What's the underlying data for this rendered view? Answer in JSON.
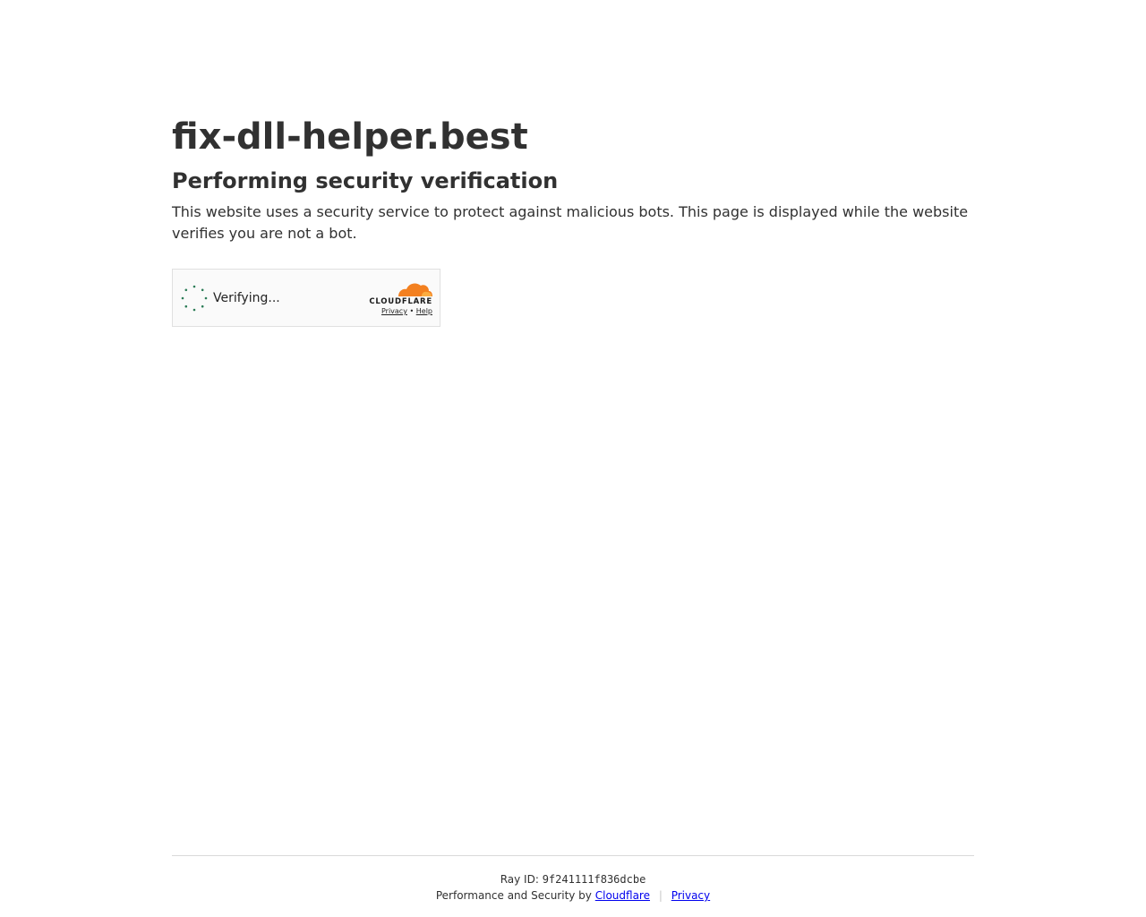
{
  "site": {
    "domain": "fix-dll-helper.best"
  },
  "content": {
    "heading": "Performing security verification",
    "description": "This website uses a security service to protect against malicious bots. This page is displayed while the website verifies you are not a bot."
  },
  "widget": {
    "status": "Verifying...",
    "brand": "CLOUDFLARE",
    "privacy_label": "Privacy",
    "bullet": "•",
    "help_label": "Help",
    "spinner_color": "#2c7c57",
    "cloud_color": "#f38020",
    "cloud_light_color": "#fbad41"
  },
  "footer": {
    "ray_label": "Ray ID:",
    "ray_id": "9f241111f836dcbe",
    "perf_prefix": "Performance and Security by",
    "cloudflare_link": "Cloudflare",
    "separator": "|",
    "privacy_link": "Privacy"
  }
}
